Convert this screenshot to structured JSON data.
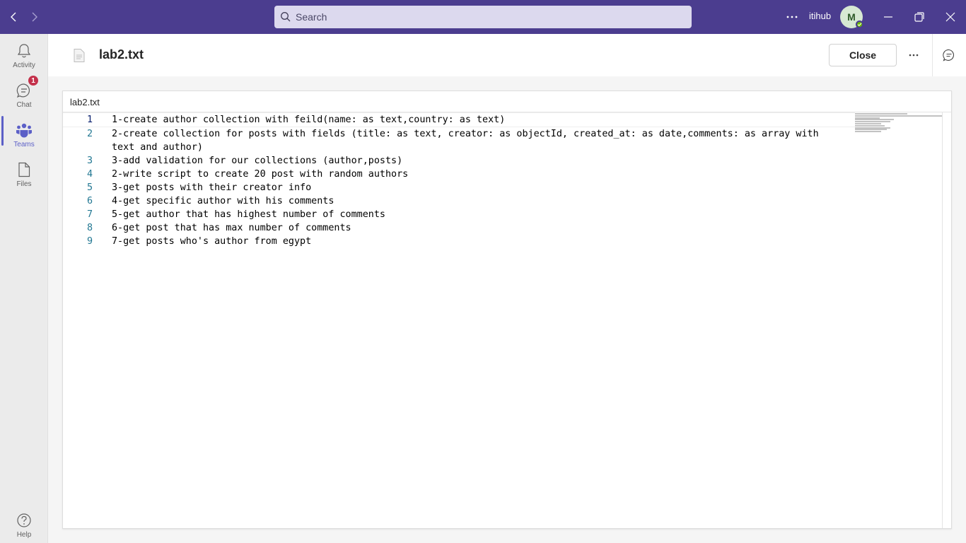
{
  "titlebar": {
    "search_placeholder": "Search",
    "org_name": "itihub",
    "avatar_initial": "M",
    "colors": {
      "bar": "#4b3d8f",
      "search": "#dcd9ee"
    }
  },
  "rail": {
    "items": [
      {
        "label": "Activity",
        "icon": "bell-icon"
      },
      {
        "label": "Chat",
        "icon": "chat-icon",
        "badge": "1"
      },
      {
        "label": "Teams",
        "icon": "teams-icon",
        "active": true
      },
      {
        "label": "Files",
        "icon": "file-icon"
      }
    ],
    "help_label": "Help",
    "accent": "#5b5fc7"
  },
  "header": {
    "file_title": "lab2.txt",
    "close_label": "Close"
  },
  "viewer": {
    "file_name": "lab2.txt",
    "lines": [
      {
        "num": "1",
        "text": "1-create author collection with feild(name: as text,country: as text)"
      },
      {
        "num": "2",
        "text": "2-create collection for posts with fields (title: as text, creator: as objectId, created_at: as date,comments: as array with text and author)"
      },
      {
        "num": "3",
        "text": "3-add validation for our collections (author,posts)"
      },
      {
        "num": "4",
        "text": "2-write script to create 20 post with random authors"
      },
      {
        "num": "5",
        "text": "3-get posts with their creator info"
      },
      {
        "num": "6",
        "text": "4-get specific author with his comments"
      },
      {
        "num": "7",
        "text": "5-get author that has highest number of comments"
      },
      {
        "num": "8",
        "text": "6-get post that has max number of comments"
      },
      {
        "num": "9",
        "text": "7-get posts who's author from egypt"
      }
    ]
  }
}
